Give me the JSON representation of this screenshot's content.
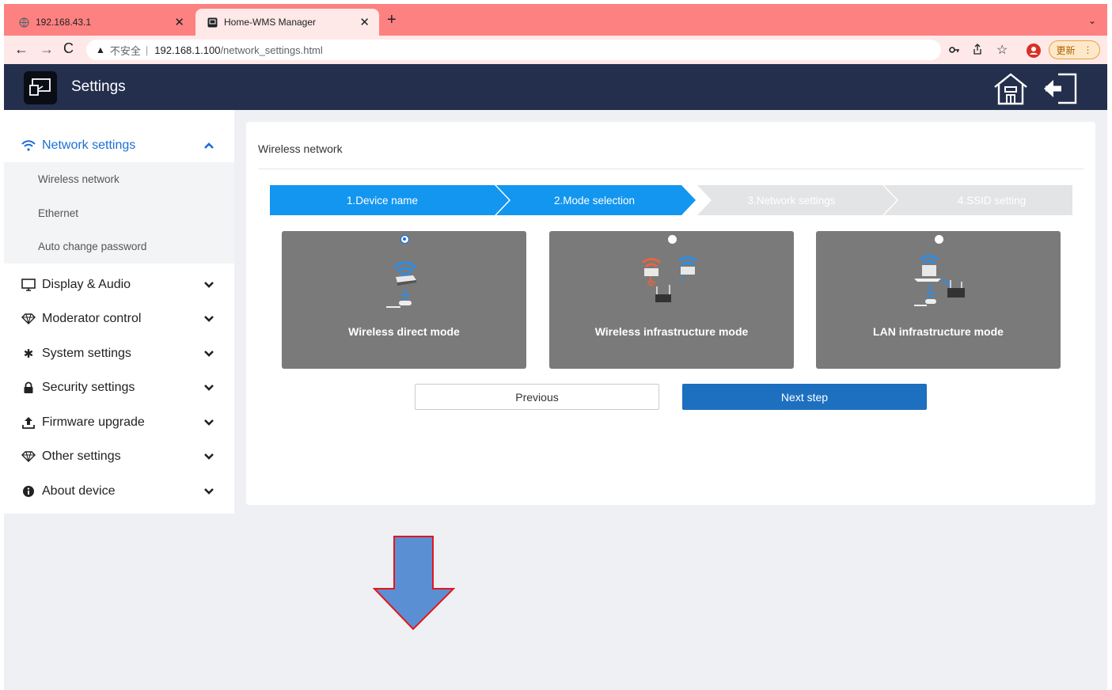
{
  "browser": {
    "tabs": [
      {
        "title": "192.168.43.1",
        "active": false
      },
      {
        "title": "Home-WMS Manager",
        "active": true
      }
    ],
    "address": {
      "security_label": "不安全",
      "host": "192.168.1.100",
      "path": "/network_settings.html"
    },
    "update_label": "更新"
  },
  "app": {
    "title": "Settings"
  },
  "sidebar": {
    "active_section": {
      "label": "Network settings",
      "subitems": [
        "Wireless network",
        "Ethernet",
        "Auto change password"
      ]
    },
    "sections": [
      {
        "label": "Display & Audio",
        "icon": "monitor-icon"
      },
      {
        "label": "Moderator control",
        "icon": "diamond-icon"
      },
      {
        "label": "System settings",
        "icon": "gear-icon"
      },
      {
        "label": "Security settings",
        "icon": "lock-icon"
      },
      {
        "label": "Firmware upgrade",
        "icon": "upload-icon"
      },
      {
        "label": "Other settings",
        "icon": "diamond-icon"
      },
      {
        "label": "About device",
        "icon": "info-icon"
      }
    ]
  },
  "main": {
    "title": "Wireless network",
    "steps": [
      {
        "label": "1.Device name",
        "state": "done"
      },
      {
        "label": "2.Mode selection",
        "state": "current"
      },
      {
        "label": "3.Network settings",
        "state": "pending"
      },
      {
        "label": "4.SSID setting",
        "state": "pending"
      }
    ],
    "modes": [
      {
        "label": "Wireless direct mode",
        "selected": true
      },
      {
        "label": "Wireless infrastructure mode",
        "selected": false
      },
      {
        "label": "LAN infrastructure mode",
        "selected": false
      }
    ],
    "buttons": {
      "previous": "Previous",
      "next": "Next step"
    }
  },
  "colors": {
    "tab_bar": "#fd8180",
    "header": "#232f4d",
    "step_active": "#1296f0",
    "step_inactive": "#e3e4e6",
    "primary_button": "#1d6fc0",
    "mode_card": "#7a7a7a",
    "arrow_fill": "#5b8fd4",
    "arrow_stroke": "#e3161b"
  }
}
